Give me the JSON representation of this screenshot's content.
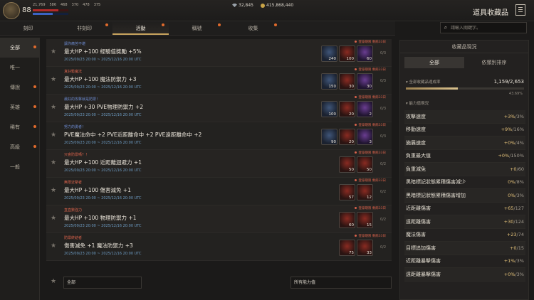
{
  "header": {
    "level": "88",
    "stats": [
      "21,769",
      "586",
      "468",
      "370",
      "478",
      "375"
    ],
    "hp_fraction": 0.72,
    "mp_fraction": 0.55,
    "currency_silver": "32,845",
    "currency_gold": "415,868,440",
    "title": "道具收藏品"
  },
  "tabs": [
    {
      "label": "刻印",
      "active": false,
      "dot": false
    },
    {
      "label": "非刻印",
      "active": false,
      "dot": true
    },
    {
      "label": "活動",
      "active": true,
      "dot": true
    },
    {
      "label": "稱號",
      "active": false,
      "dot": true
    },
    {
      "label": "收集",
      "active": false,
      "dot": true
    }
  ],
  "search": {
    "placeholder": "請輸入關鍵字。"
  },
  "sidebar": [
    {
      "label": "全部",
      "active": true,
      "dot": true
    },
    {
      "label": "唯一",
      "active": false,
      "dot": false
    },
    {
      "label": "傳說",
      "active": false,
      "dot": true
    },
    {
      "label": "英雄",
      "active": false,
      "dot": true
    },
    {
      "label": "稀有",
      "active": false,
      "dot": true
    },
    {
      "label": "高級",
      "active": false,
      "dot": true
    },
    {
      "label": "一般",
      "active": false,
      "dot": false
    }
  ],
  "list": [
    {
      "category": "讓你痛苦不堪",
      "cat_color": "blue",
      "effect": "最大HP +100 經驗值獎勵 +5%",
      "date": "2025/09/23 20:00 ~ 2025/12/16 20:00 UTC",
      "tag": "登錄期限 剩餘33日",
      "slots": [
        {
          "c": "blue",
          "n": "240"
        },
        {
          "c": "red",
          "n": "100"
        },
        {
          "c": "purple",
          "n": "60"
        }
      ],
      "count": "0/3"
    },
    {
      "category": "真好鬆魔法",
      "cat_color": "red",
      "effect": "最大HP +100 魔法防禦力 +3",
      "date": "2025/09/23 20:00 ~ 2025/12/16 20:00 UTC",
      "tag": "登錄期限 剩餘33日",
      "slots": [
        {
          "c": "blue",
          "n": "150"
        },
        {
          "c": "red",
          "n": "30"
        },
        {
          "c": "purple",
          "n": "30"
        }
      ],
      "count": "0/3"
    },
    {
      "category": "最好的攻擊就是防禦！",
      "cat_color": "blue",
      "effect": "最大HP +30 PVE物理防禦力 +2",
      "date": "2025/09/23 20:00 ~ 2025/12/16 20:00 UTC",
      "tag": "登錄期限 剩餘33日",
      "slots": [
        {
          "c": "blue",
          "n": "100"
        },
        {
          "c": "red",
          "n": "20"
        },
        {
          "c": "purple",
          "n": "2"
        }
      ],
      "count": "0/3"
    },
    {
      "category": "努力的勇者！",
      "cat_color": "blue",
      "effect": "PVE魔法命中 +2 PVE近距離命中 +2 PVE遠距離命中 +2",
      "date": "2025/09/23 20:00 ~ 2025/12/16 20:00 UTC",
      "tag": "登錄期限 剩餘33日",
      "slots": [
        {
          "c": "blue",
          "n": "90"
        },
        {
          "c": "red",
          "n": "20"
        },
        {
          "c": "purple",
          "n": "3"
        }
      ],
      "count": "0/3"
    },
    {
      "category": "只會防禦嗎？！",
      "cat_color": "red",
      "effect": "最大HP +100 近距離迴避力 +1",
      "date": "2025/09/23 20:00 ~ 2025/12/16 20:00 UTC",
      "tag": "登錄期限 剩餘33日",
      "slots": [
        {
          "c": "red",
          "n": "50"
        },
        {
          "c": "red",
          "n": "50"
        }
      ],
      "count": "0/2"
    },
    {
      "category": "無限近擊者",
      "cat_color": "red",
      "effect": "最大HP +100 傷害減免 +1",
      "date": "2025/09/23 20:00 ~ 2025/12/16 20:00 UTC",
      "tag": "登錄期限 剩餘33日",
      "slots": [
        {
          "c": "red",
          "n": "57"
        },
        {
          "c": "red",
          "n": "12"
        }
      ],
      "count": "0/2"
    },
    {
      "category": "直直數強力",
      "cat_color": "red",
      "effect": "最大HP +100 物理防禦力 +1",
      "date": "2025/09/23 20:00 ~ 2025/12/16 20:00 UTC",
      "tag": "登錄期限 剩餘33日",
      "slots": [
        {
          "c": "red",
          "n": "60"
        },
        {
          "c": "red",
          "n": "15"
        }
      ],
      "count": "0/2"
    },
    {
      "category": "防禦終結者",
      "cat_color": "red",
      "effect": "傷害減免 +1 魔法防禦力 +3",
      "date": "2025/09/23 20:00 ~ 2025/12/16 20:00 UTC",
      "tag": "登錄期限 剩餘33日",
      "slots": [
        {
          "c": "red",
          "n": "75"
        },
        {
          "c": "red",
          "n": "33"
        }
      ],
      "count": "0/2"
    }
  ],
  "bottom": {
    "filter_left": "全部",
    "filter_right": "所有能力值"
  },
  "panel": {
    "title": "收藏品現況",
    "tab_all": "全部",
    "tab_sort": "依類別排序",
    "rate_label": "全部收藏品達成率",
    "rate_value": "1,159/2,653",
    "rate_fraction": 0.4369,
    "rate_pct": "43.69%",
    "sec2": "能力值現況",
    "stats": [
      {
        "name": "攻擊速度",
        "cur": "+3%",
        "max": "/3%"
      },
      {
        "name": "移動速度",
        "cur": "+9%",
        "max": "/16%"
      },
      {
        "name": "施展速度",
        "cur": "+0%",
        "max": "/4%"
      },
      {
        "name": "負重最大值",
        "cur": "+0%",
        "max": "/150%"
      },
      {
        "name": "負重減免",
        "cur": "+0",
        "max": "/60"
      },
      {
        "name": "黑暗標記狀態累積傷害減少",
        "cur": "0%",
        "max": "/8%"
      },
      {
        "name": "黑暗標記狀態累積傷害增加",
        "cur": "0%",
        "max": "/3%"
      },
      {
        "name": "近距離傷害",
        "cur": "+65",
        "max": "/127"
      },
      {
        "name": "遠距離傷害",
        "cur": "+30",
        "max": "/124"
      },
      {
        "name": "魔法傷害",
        "cur": "+23",
        "max": "/74"
      },
      {
        "name": "目標追加傷害",
        "cur": "+0",
        "max": "/15"
      },
      {
        "name": "近距離暴擊傷害",
        "cur": "+1%",
        "max": "/3%"
      },
      {
        "name": "遠距離暴擊傷害",
        "cur": "+0%",
        "max": "/3%"
      }
    ]
  }
}
